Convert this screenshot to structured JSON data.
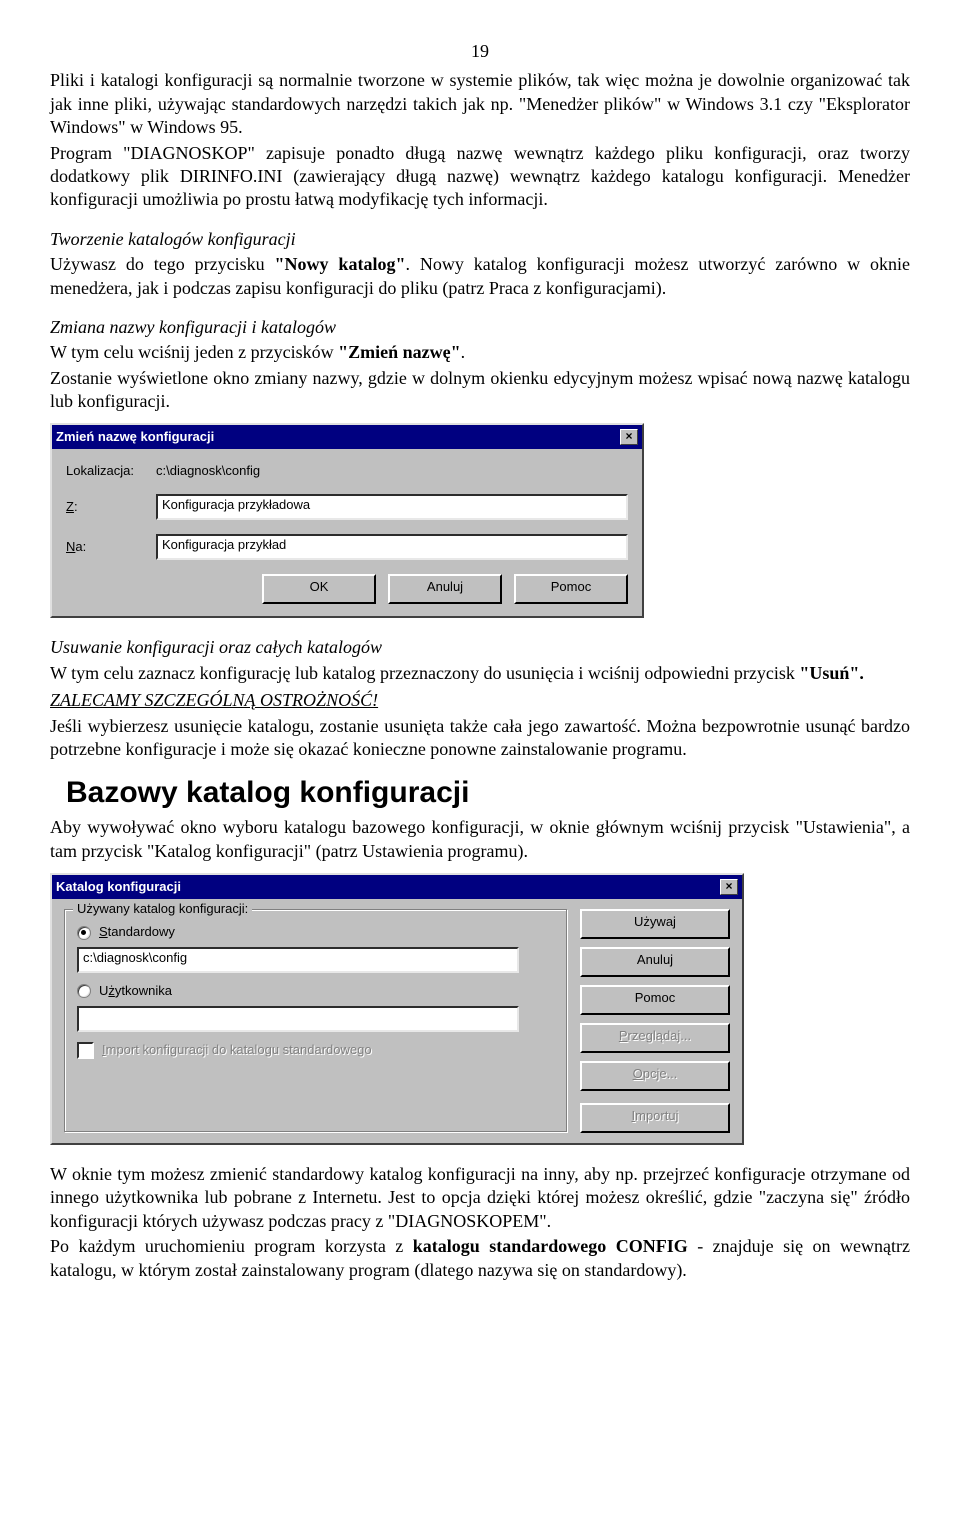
{
  "page_number": "19",
  "p1": "Pliki i katalogi konfiguracji są normalnie tworzone w systemie plików, tak więc można je dowolnie organizować tak jak inne pliki, używając standardowych narzędzi takich jak np. \"Menedżer plików\" w Windows 3.1 czy \"Eksplorator Windows\" w Windows 95.",
  "p2": "Program \"DIAGNOSKOP\" zapisuje ponadto długą nazwę wewnątrz każdego pliku konfiguracji, oraz tworzy dodatkowy plik DIRINFO.INI (zawierający długą nazwę) wewnątrz każdego katalogu konfiguracji. Menedżer konfiguracji umożliwia po prostu łatwą modyfikację tych informacji.",
  "s1_title": "Tworzenie katalogów konfiguracji",
  "s1_a": "Używasz do tego przycisku ",
  "s1_b": "\"Nowy katalog\"",
  "s1_c": ". Nowy katalog konfiguracji możesz utworzyć zarówno w oknie menedżera, jak i podczas zapisu konfiguracji do pliku (patrz Praca z konfiguracjami).",
  "s2_title": "Zmiana nazwy konfiguracji i katalogów",
  "s2_a": "W tym celu wciśnij jeden z przycisków ",
  "s2_b": "\"Zmień nazwę\"",
  "s2_c": ".",
  "s2_d": "Zostanie wyświetlone okno zmiany nazwy, gdzie w dolnym okienku edycyjnym możesz wpisać nową nazwę katalogu lub konfiguracji.",
  "dlg1": {
    "title": "Zmień nazwę konfiguracji",
    "lok_label": "Lokalizacja:",
    "lok_value": "c:\\diagnosk\\config",
    "z_label": "Z:",
    "z_value": "Konfiguracja przykładowa",
    "na_label": "Na:",
    "na_value": "Konfiguracja przykład",
    "ok": "OK",
    "anuluj": "Anuluj",
    "pomoc": "Pomoc"
  },
  "s3_title": "Usuwanie konfiguracji oraz całych katalogów",
  "s3_a": "W tym celu zaznacz konfigurację lub katalog przeznaczony do usunięcia i wciśnij odpowiedni przycisk ",
  "s3_b": "\"Usuń\".",
  "warn": "ZALECAMY SZCZEGÓLNĄ OSTROŻNOŚĆ!",
  "warn_p": "Jeśli wybierzesz usunięcie katalogu, zostanie usunięta także cała jego zawartość. Można bezpowrotnie usunąć bardzo potrzebne konfiguracje i może się okazać konieczne ponowne zainstalowanie programu.",
  "h2": "Bazowy katalog konfiguracji",
  "h2_p": "Aby wywoływać okno wyboru katalogu bazowego konfiguracji, w oknie głównym wciśnij przycisk \"Ustawienia\", a tam przycisk \"Katalog konfiguracji\" (patrz Ustawienia programu).",
  "dlg2": {
    "title": "Katalog konfiguracji",
    "group": "Używany katalog konfiguracji:",
    "std": "Standardowy",
    "std_val": "c:\\diagnosk\\config",
    "usr": "Użytkownika",
    "usr_val": "",
    "import_chk": "Import konfiguracji do katalogu standardowego",
    "uzywaj": "Używaj",
    "anuluj": "Anuluj",
    "pomoc": "Pomoc",
    "przegladaj": "Przeglądaj...",
    "opcje": "Opcje...",
    "importuj": "Importuj"
  },
  "p_end1": "W oknie tym możesz zmienić standardowy katalog konfiguracji na inny, aby np. przejrzeć konfiguracje otrzymane od innego użytkownika lub pobrane z Internetu. Jest to opcja dzięki której możesz określić, gdzie \"zaczyna się\" źródło konfiguracji których używasz podczas pracy z \"DIAGNOSKOPEM\".",
  "p_end2_a": "Po każdym uruchomieniu program korzysta z ",
  "p_end2_b": "katalogu standardowego CONFIG",
  "p_end2_c": " - znajduje się on wewnątrz katalogu, w którym został zainstalowany program (dlatego nazywa się on standardowy)."
}
